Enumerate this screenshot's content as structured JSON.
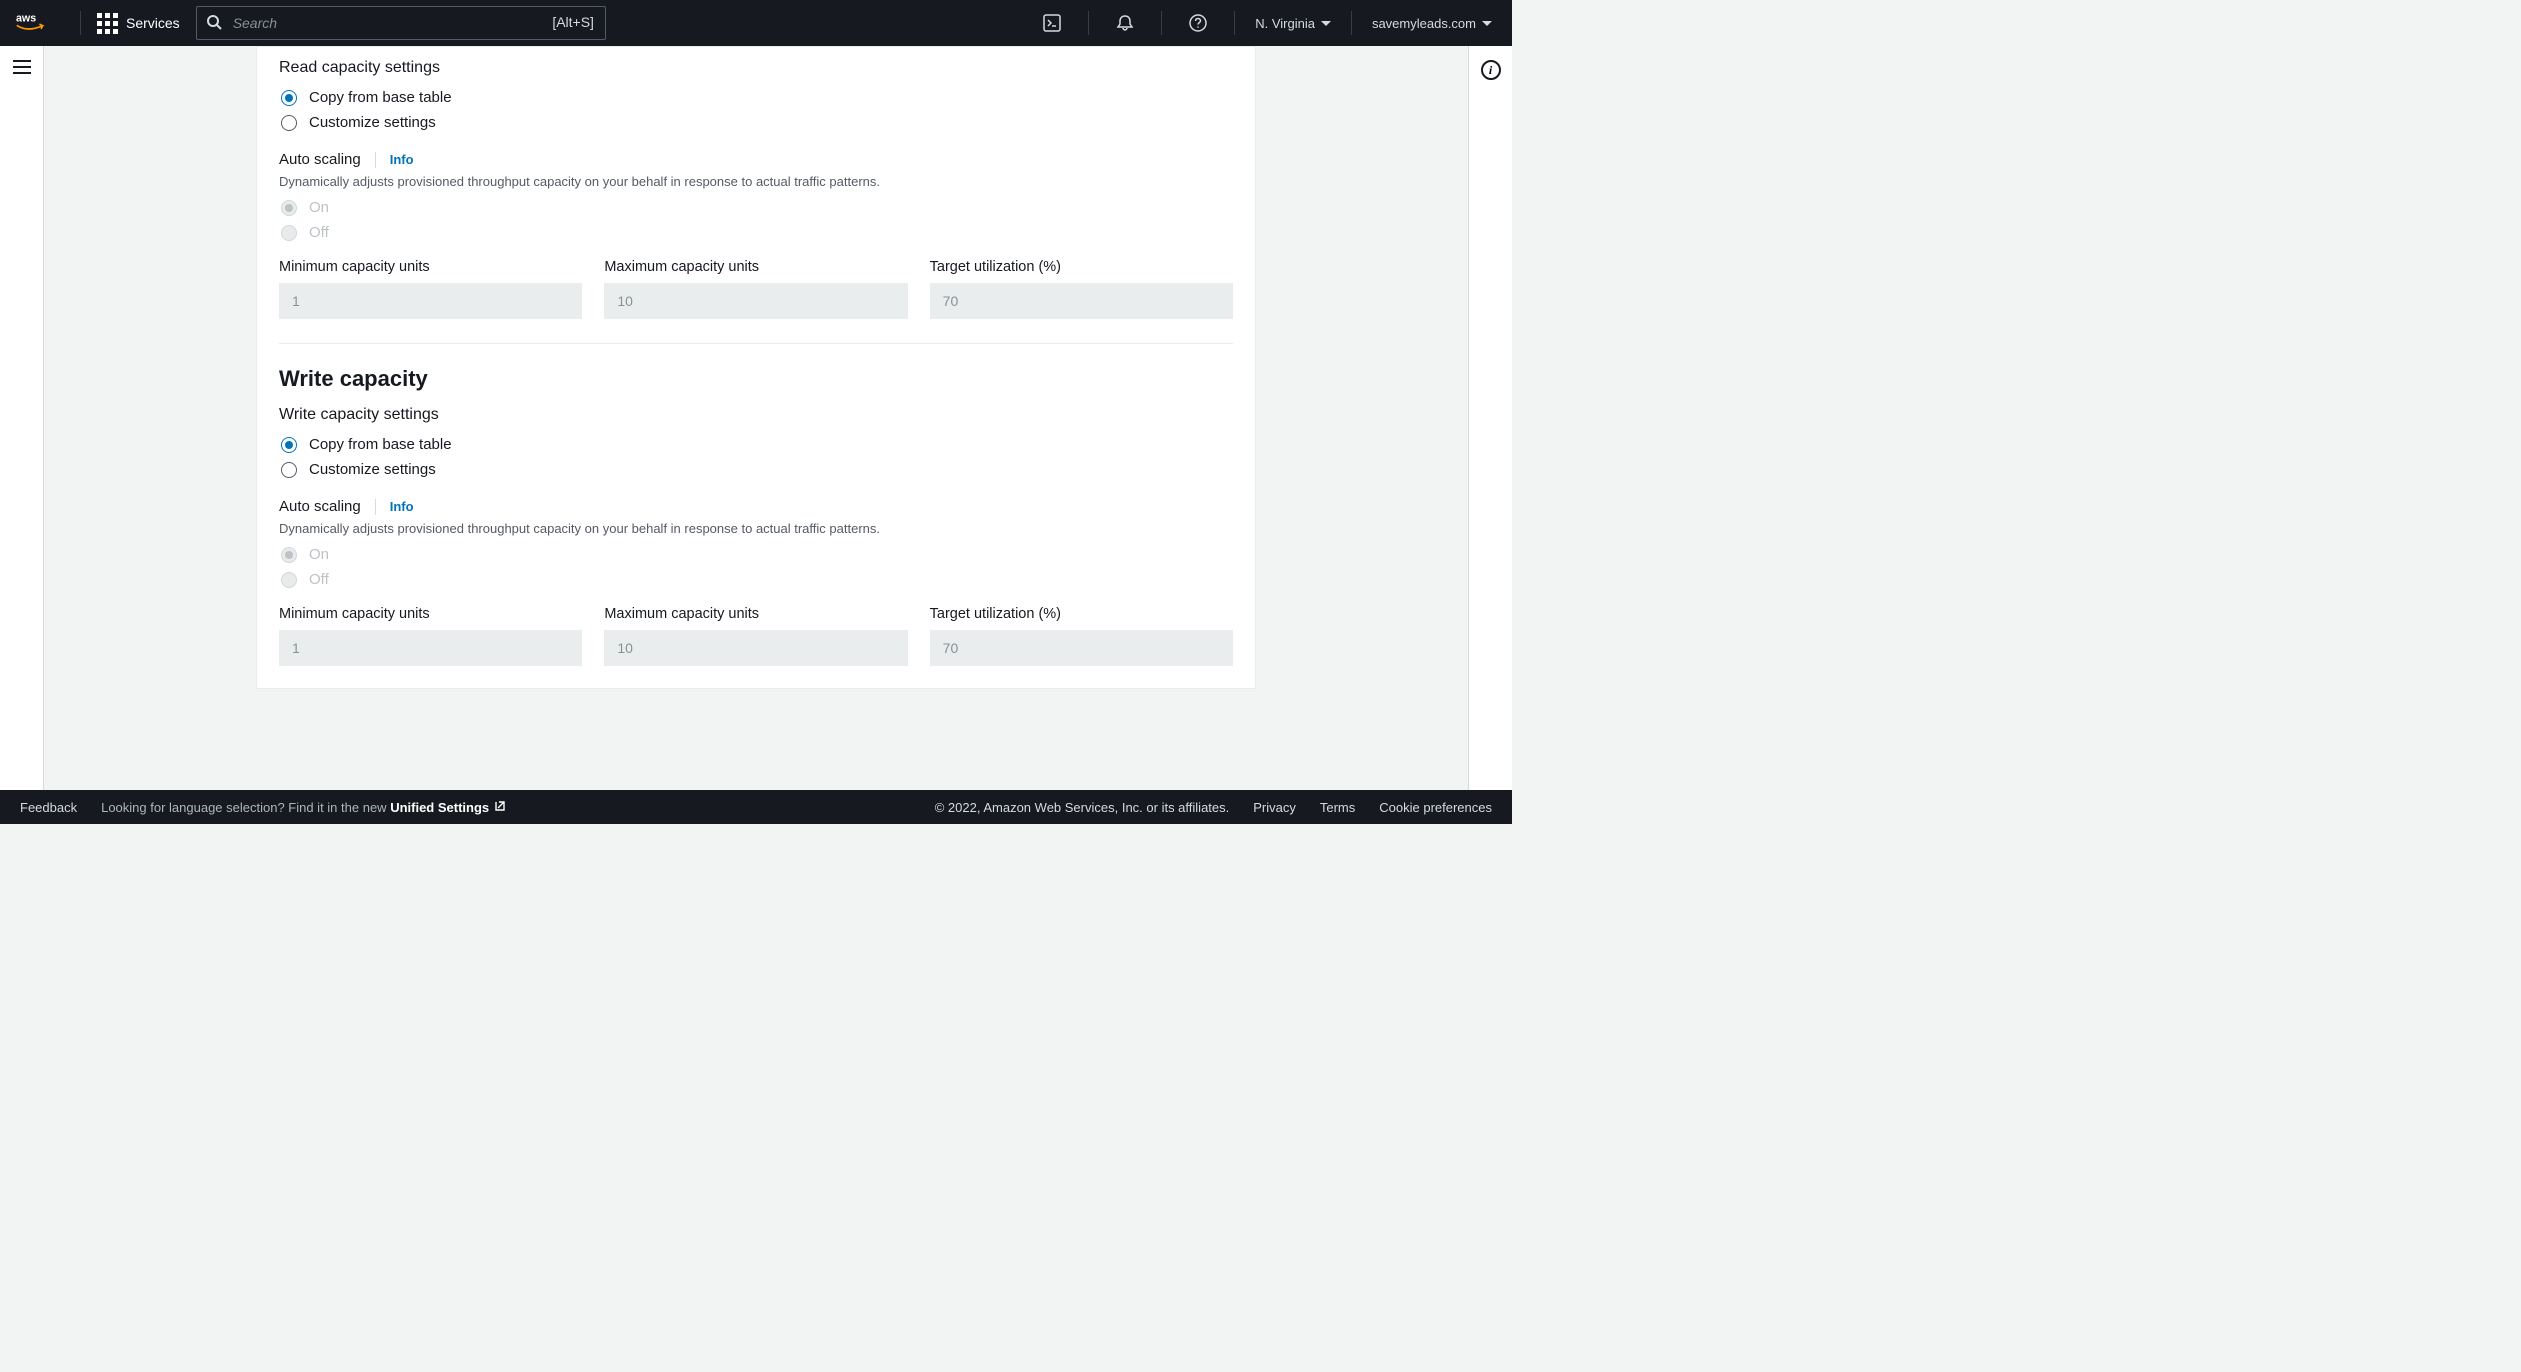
{
  "nav": {
    "services": "Services",
    "search_placeholder": "Search",
    "search_shortcut": "[Alt+S]",
    "region": "N. Virginia",
    "account": "savemyleads.com"
  },
  "read": {
    "settings_label": "Read capacity settings",
    "copy_option": "Copy from base table",
    "customize_option": "Customize settings",
    "autoscaling_label": "Auto scaling",
    "info": "Info",
    "desc": "Dynamically adjusts provisioned throughput capacity on your behalf in response to actual traffic patterns.",
    "on": "On",
    "off": "Off",
    "min_label": "Minimum capacity units",
    "max_label": "Maximum capacity units",
    "target_label": "Target utilization (%)",
    "min_val": "1",
    "max_val": "10",
    "target_val": "70"
  },
  "write": {
    "title": "Write capacity",
    "settings_label": "Write capacity settings",
    "copy_option": "Copy from base table",
    "customize_option": "Customize settings",
    "autoscaling_label": "Auto scaling",
    "info": "Info",
    "desc": "Dynamically adjusts provisioned throughput capacity on your behalf in response to actual traffic patterns.",
    "on": "On",
    "off": "Off",
    "min_label": "Minimum capacity units",
    "max_label": "Maximum capacity units",
    "target_label": "Target utilization (%)",
    "min_val": "1",
    "max_val": "10",
    "target_val": "70"
  },
  "footer": {
    "feedback": "Feedback",
    "lang_prefix": "Looking for language selection? Find it in the new ",
    "unified": "Unified Settings",
    "copyright": "© 2022, Amazon Web Services, Inc. or its affiliates.",
    "privacy": "Privacy",
    "terms": "Terms",
    "cookie": "Cookie preferences"
  }
}
